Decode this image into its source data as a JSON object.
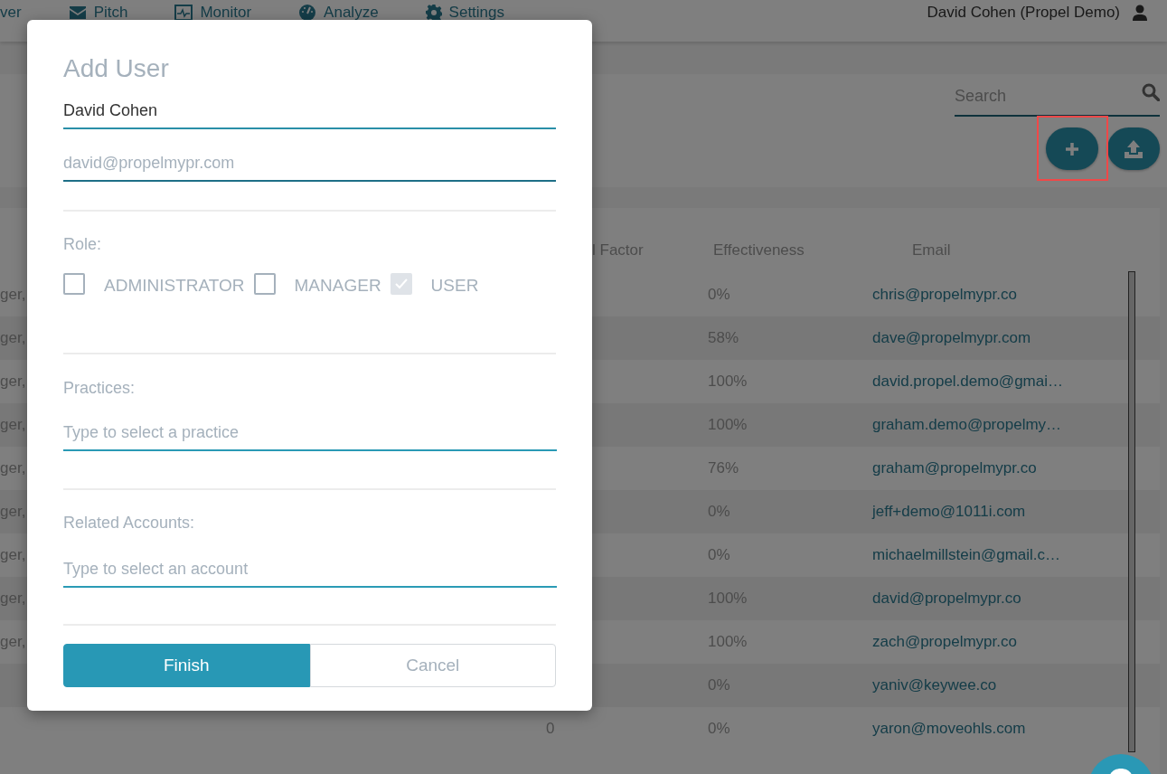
{
  "nav": {
    "items": [
      {
        "label": "ver"
      },
      {
        "label": "Pitch",
        "kind": "envelope"
      },
      {
        "label": "Monitor",
        "kind": "monitor"
      },
      {
        "label": "Analyze",
        "kind": "gauge"
      },
      {
        "label": "Settings",
        "kind": "gear"
      }
    ],
    "user": "David Cohen (Propel Demo)"
  },
  "toolbar": {
    "search": {
      "placeholder": "Search"
    },
    "buttons": [
      {
        "kind": "add",
        "highlighted": true
      },
      {
        "kind": "upload",
        "highlighted": false
      }
    ]
  },
  "table": {
    "columns": [
      "l Factor",
      "Effectiveness",
      "Email"
    ],
    "rows": [
      {
        "column_1": "ger,",
        "effectiveness": "0%",
        "email": "chris@propelmypr.co"
      },
      {
        "column_1": "ger,",
        "effectiveness": "58%",
        "email": "dave@propelmypr.com"
      },
      {
        "column_1": "ger,",
        "effectiveness": "100%",
        "email": "david.propel.demo@gmai…"
      },
      {
        "column_1": "ger,",
        "effectiveness": "100%",
        "email": "graham.demo@propelmy…"
      },
      {
        "column_1": "ger,",
        "effectiveness": "76%",
        "email": "graham@propelmypr.co"
      },
      {
        "column_1": "ger,",
        "effectiveness": "0%",
        "email": "jeff+demo@1011i.com"
      },
      {
        "column_1": "ger,",
        "effectiveness": "0%",
        "email": "michaelmillstein@gmail.c…"
      },
      {
        "column_1": "ger,",
        "effectiveness": "100%",
        "email": "david@propelmypr.co"
      },
      {
        "column_1": "ger,",
        "effectiveness": "100%",
        "email": "zach@propelmypr.co"
      },
      {
        "effectiveness": "0%",
        "email": "yaniv@keywee.co"
      },
      {
        "column_3": "0",
        "effectiveness": "0%",
        "email": "yaron@moveohls.com"
      }
    ]
  },
  "dialog": {
    "title": "Add User",
    "name_field": {
      "value": "David Cohen"
    },
    "email_field": {
      "placeholder": "david@propelmypr.com"
    },
    "role": {
      "label": "Role:",
      "options": [
        {
          "label": "ADMINISTRATOR",
          "checked": false,
          "disabled": false
        },
        {
          "label": "MANAGER",
          "checked": false,
          "disabled": false
        },
        {
          "label": "USER",
          "checked": true,
          "disabled": true
        }
      ]
    },
    "practices": {
      "label": "Practices:",
      "placeholder": "Type to select a practice"
    },
    "accounts": {
      "label": "Related Accounts:",
      "placeholder": "Type to select an account"
    },
    "buttons": [
      {
        "label": "Finish",
        "kind": "primary"
      },
      {
        "label": "Cancel",
        "kind": "secondary"
      }
    ]
  },
  "chat_button": {
    "kind": "chat"
  }
}
